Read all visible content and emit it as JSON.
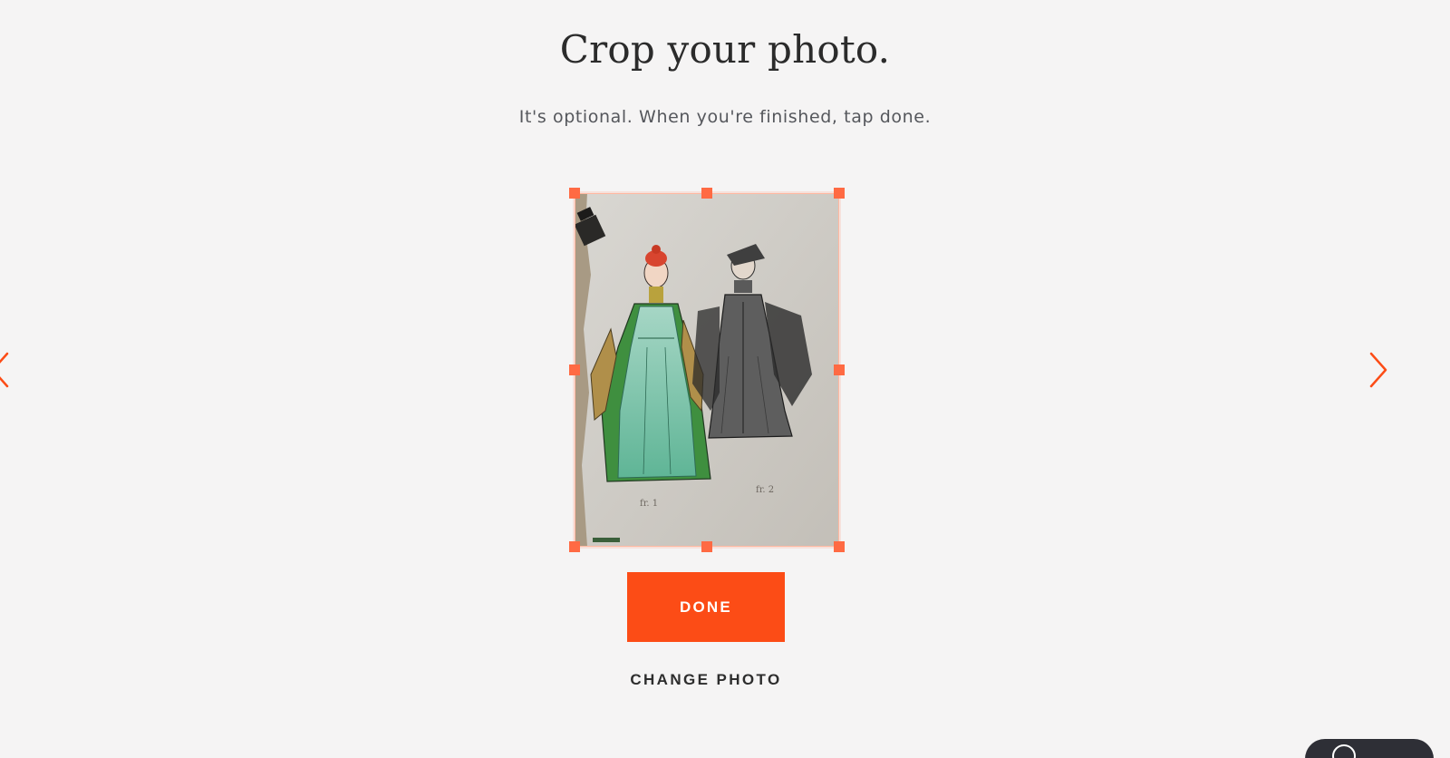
{
  "page": {
    "title": "Crop your photo.",
    "subtitle": "It's optional. When you're finished, tap done."
  },
  "crop": {
    "photo_icon": "costume-sketch-photo"
  },
  "actions": {
    "done_label": "DONE",
    "change_photo_label": "CHANGE PHOTO"
  },
  "nav": {
    "prev_icon": "chevron-left-icon",
    "next_icon": "chevron-right-icon"
  },
  "help": {
    "icon": "help-icon"
  },
  "colors": {
    "accent": "#fc4c16",
    "handle": "#ff6a43",
    "background": "#f5f4f4",
    "text": "#2b2b2b"
  }
}
